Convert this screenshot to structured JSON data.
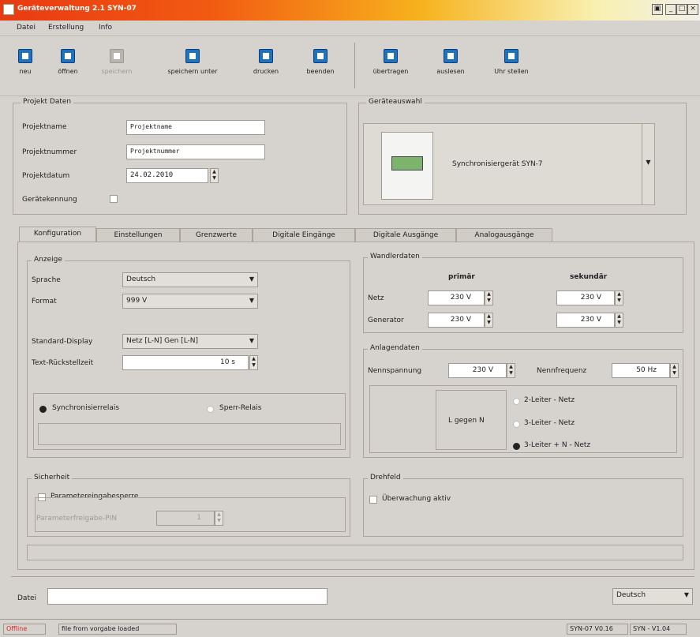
{
  "window": {
    "title": "Geräteverwaltung 2.1 SYN-07"
  },
  "menu": [
    "Datei",
    "Erstellung",
    "Info"
  ],
  "toolbar": {
    "neu": "neu",
    "oeffnen": "öffnen",
    "speichern": "speichern",
    "speichern_unter": "speichern unter",
    "drucken": "drucken",
    "beenden": "beenden",
    "uebertragen": "übertragen",
    "auslesen": "auslesen",
    "uhr_stellen": "Uhr stellen"
  },
  "projekt": {
    "title": "Projekt Daten",
    "name_label": "Projektname",
    "name_value": "Projektname",
    "nummer_label": "Projektnummer",
    "nummer_value": "Projektnummer",
    "datum_label": "Projektdatum",
    "datum_value": "24.02.2010",
    "kennung_label": "Gerätekennung"
  },
  "geraet": {
    "title": "Geräteauswahl",
    "selected": "Synchronisiergerät SYN-7"
  },
  "tabs": [
    "Konfiguration",
    "Einstellungen",
    "Grenzwerte",
    "Digitale Eingänge",
    "Digitale Ausgänge",
    "Analogausgänge"
  ],
  "anzeige": {
    "title": "Anzeige",
    "sprache_label": "Sprache",
    "sprache_value": "Deutsch",
    "format_label": "Format",
    "format_value": "999 V",
    "standard_label": "Standard-Display",
    "standard_value": "Netz [L-N] Gen [L-N]",
    "rueck_label": "Text-Rückstellzeit",
    "rueck_value": "10 s",
    "radio1": "Synchronisierrelais",
    "radio2": "Sperr-Relais"
  },
  "wandler": {
    "title": "Wandlerdaten",
    "primaer": "primär",
    "sekundaer": "sekundär",
    "netz_label": "Netz",
    "generator_label": "Generator",
    "netz_p": "230 V",
    "netz_s": "230 V",
    "gen_p": "230 V",
    "gen_s": "230 V"
  },
  "anlagen": {
    "title": "Anlagendaten",
    "nennspannung_label": "Nennspannung",
    "nennspannung_value": "230 V",
    "nennfrequenz_label": "Nennfrequenz",
    "nennfrequenz_value": "50 Hz",
    "lgegen": "L gegen N",
    "opt1": "2-Leiter - Netz",
    "opt2": "3-Leiter - Netz",
    "opt3": "3-Leiter + N - Netz"
  },
  "sicherheit": {
    "title": "Sicherheit",
    "sperre_label": "Parametereingabesperre",
    "pin_label": "Parameterfreigabe-PIN",
    "pin_value": "1"
  },
  "drehfeld": {
    "title": "Drehfeld",
    "check_label": "Überwachung aktiv"
  },
  "footer": {
    "datei_label": "Datei",
    "lang": "Deutsch"
  },
  "status": {
    "offline": "Offline",
    "message": "file from vorgabe loaded",
    "ver1": "SYN-07 V0.16",
    "ver2": "SYN - V1.04"
  }
}
